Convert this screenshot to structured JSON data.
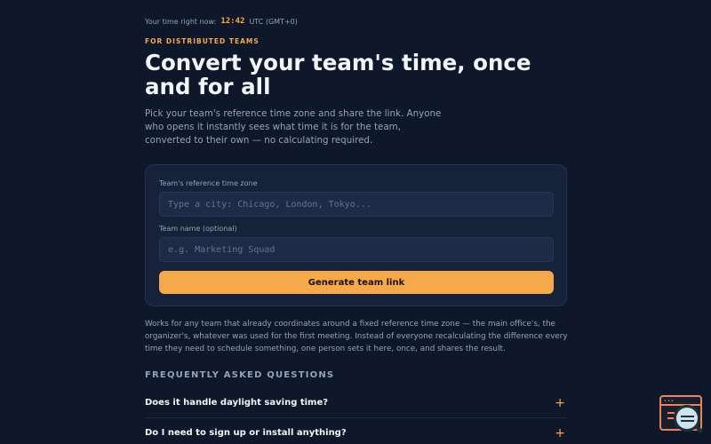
{
  "header": {
    "time_label": "Your time right now:",
    "time_value": "12:42",
    "timezone": "UTC (GMT+0)"
  },
  "hero": {
    "eyebrow": "FOR DISTRIBUTED TEAMS",
    "title": "Convert your team's time, once and for all",
    "subtitle": "Pick your team's reference time zone and share the link. Anyone who opens it instantly sees what time it is for the team, converted to their own — no calculating required."
  },
  "form": {
    "timezone_label": "Team's reference time zone",
    "timezone_placeholder": "Type a city: Chicago, London, Tokyo...",
    "name_label": "Team name (optional)",
    "name_placeholder": "e.g. Marketing Squad",
    "submit_label": "Generate team link"
  },
  "description": "Works for any team that already coordinates around a fixed reference time zone — the main office's, the organizer's, whatever was used for the first meeting. Instead of everyone recalculating the difference every time they need to schedule something, one person sets it here, once, and shares the result.",
  "faq": {
    "heading": "FREQUENTLY ASKED QUESTIONS",
    "items": [
      {
        "question": "Does it handle daylight saving time?",
        "toggle": "+"
      },
      {
        "question": "Do I need to sign up or install anything?",
        "toggle": "+"
      }
    ]
  },
  "widget": {
    "icon": "feedback-magnifier-icon",
    "dots": "•••"
  },
  "colors": {
    "background": "#0f172a",
    "accent": "#f6a94a",
    "card": "#16213a"
  }
}
